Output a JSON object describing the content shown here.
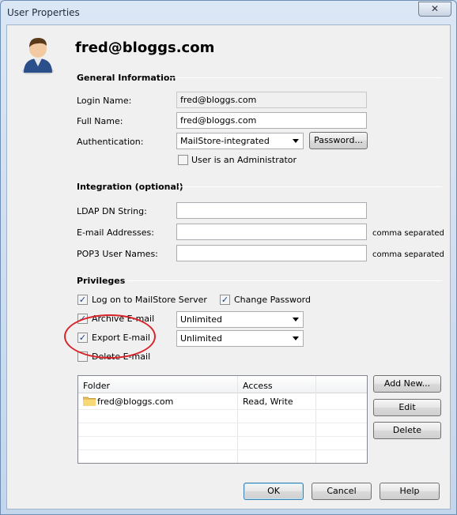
{
  "window": {
    "title": "User Properties",
    "close_glyph": "✕"
  },
  "header": {
    "user": "fred@bloggs.com"
  },
  "general": {
    "title": "General Information",
    "login_label": "Login Name:",
    "login_value": "fred@bloggs.com",
    "fullname_label": "Full Name:",
    "fullname_value": "fred@bloggs.com",
    "auth_label": "Authentication:",
    "auth_value": "MailStore-integrated",
    "password_button": "Password...",
    "admin_label": "User is an Administrator",
    "admin_checked": false
  },
  "integration": {
    "title": "Integration (optional)",
    "ldap_label": "LDAP DN String:",
    "ldap_value": "",
    "email_label": "E-mail Addresses:",
    "email_value": "",
    "email_hint": "comma separated",
    "pop3_label": "POP3 User Names:",
    "pop3_value": "",
    "pop3_hint": "comma separated"
  },
  "privileges": {
    "title": "Privileges",
    "logon_label": "Log on to MailStore Server",
    "logon_checked": true,
    "change_pw_label": "Change Password",
    "change_pw_checked": true,
    "archive_label": "Archive E-mail",
    "archive_checked": true,
    "archive_value": "Unlimited",
    "export_label": "Export E-mail",
    "export_checked": true,
    "export_value": "Unlimited",
    "delete_label": "Delete E-mail",
    "delete_checked": false,
    "check_glyph": "✓"
  },
  "folders": {
    "columns": [
      "Folder",
      "Access"
    ],
    "rows": [
      {
        "folder": "fred@bloggs.com",
        "access": "Read, Write"
      }
    ],
    "add_button": "Add New...",
    "edit_button": "Edit",
    "delete_button": "Delete"
  },
  "footer": {
    "ok": "OK",
    "cancel": "Cancel",
    "help": "Help"
  },
  "colors": {
    "annotation": "#d8232a",
    "check": "#1a3b7a",
    "title_bar": "#dbe7f5"
  }
}
